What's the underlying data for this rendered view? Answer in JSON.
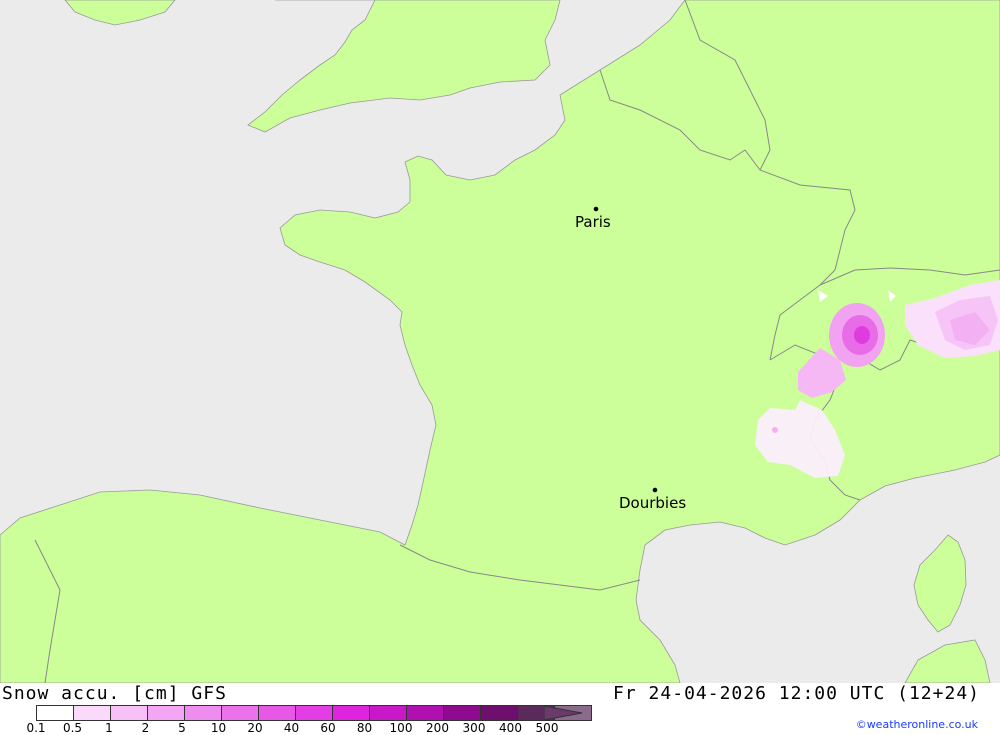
{
  "map": {
    "colors": {
      "sea": "#ebebeb",
      "land": "#ccff99",
      "border": "#888888"
    },
    "places": [
      {
        "name": "Paris"
      },
      {
        "name": "Dourbies"
      }
    ]
  },
  "legend": {
    "title": "Snow accu. [cm] GFS",
    "datetime": "Fr 24-04-2026 12:00 UTC (12+24)",
    "ticks": [
      "0.1",
      "0.5",
      "1",
      "2",
      "5",
      "10",
      "20",
      "40",
      "60",
      "80",
      "100",
      "200",
      "300",
      "400",
      "500"
    ],
    "colors": [
      "#ffffff",
      "#fbd9fb",
      "#f7c0f7",
      "#f3a6f3",
      "#ef8cef",
      "#eb72eb",
      "#e758e7",
      "#e33ee3",
      "#df24df",
      "#c818c8",
      "#b010b0",
      "#8e0a8e",
      "#6e0f6e",
      "#5a2a5a",
      "#8c6a8c"
    ]
  },
  "credit": "©weatheronline.co.uk"
}
